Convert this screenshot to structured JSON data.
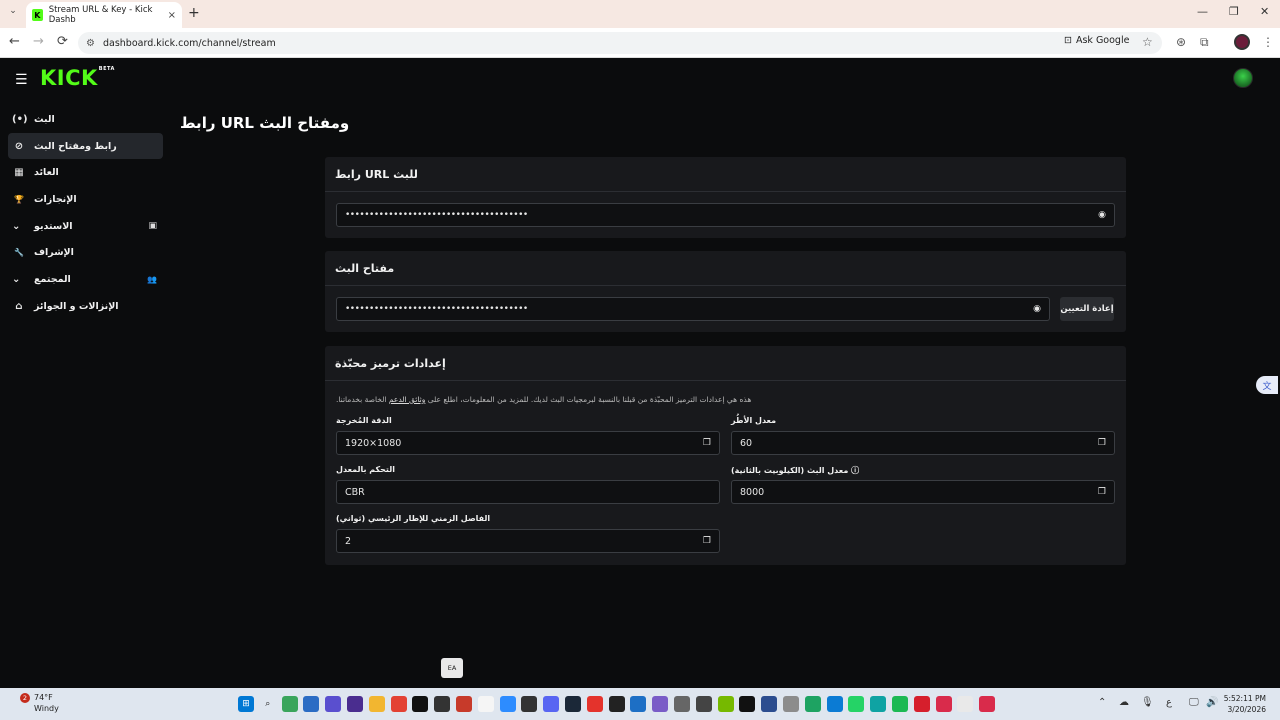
{
  "browser": {
    "tab_title": "Stream URL & Key - Kick Dashb",
    "tab_favicon": "K",
    "tab_close": "×",
    "new_tab": "+",
    "url": "dashboard.kick.com/channel/stream",
    "ask_google": "Ask Google",
    "back": "←",
    "forward": "→",
    "reload": "⟳",
    "minimize": "—",
    "restore": "❐",
    "close": "✕"
  },
  "app": {
    "logo": "KICK",
    "logo_badge": "BETA",
    "page_title": "رابط URL ومفتاح البث"
  },
  "sidebar": {
    "items": [
      {
        "label": "البث",
        "icon": "(•)"
      },
      {
        "label": "رابط ومفتاح البث",
        "icon": "⊘"
      },
      {
        "label": "العائد",
        "icon": "▦"
      },
      {
        "label": "الإنجازات",
        "icon": "🏆"
      },
      {
        "label": "الاستديو",
        "icon": "⌄",
        "right_icon": "▣"
      },
      {
        "label": "الإشراف",
        "icon": "🔧"
      },
      {
        "label": "المجتمع",
        "icon": "⌄",
        "right_icon": "👥"
      },
      {
        "label": "الإنزالات و الجوائز",
        "icon": "⌂"
      }
    ]
  },
  "stream_url_card": {
    "title": "رابط URL للبث",
    "masked_value": "••••••••••••••••••••••••••••••••••••••"
  },
  "stream_key_card": {
    "title": "مفتاح البث",
    "masked_value": "••••••••••••••••••••••••••••••••••••••",
    "reset_label": "إعادة التعيين"
  },
  "encoder_card": {
    "title": "إعدادات ترميز محبّذة",
    "description_prefix": ".هذه هي إعدادات الترميز المحبّذة من قبلنا بالنسبة لبرمجيات البث لديك. للمزيد من المعلومات، اطلع على ",
    "description_link": "وثائق الدعم",
    "description_suffix": " الخاصة بخدماتنا",
    "fields": {
      "resolution": {
        "label": "الدقة المُخرجة",
        "value": "1920×1080"
      },
      "fps": {
        "label": "معدل الأطُر",
        "value": "60"
      },
      "rate_control": {
        "label": "التحكم بالمعدل",
        "value": "CBR"
      },
      "bitrate": {
        "label": "معدل البث (الكيلوبيت بالثانية)",
        "value": "8000"
      },
      "keyframe": {
        "label": "الفاصل الزمني للإطار الرئيسي (ثواني)",
        "value": "2"
      }
    }
  },
  "tooltip": "EA",
  "taskbar": {
    "weather_temp": "74°F",
    "weather_desc": "Windy",
    "notification_count": "2",
    "time": "5:52:11 PM",
    "date": "3/20/2026",
    "lang": "ع"
  },
  "colors": {
    "kick_green": "#53fc18",
    "bg": "#0b0c0d",
    "card": "#18191c"
  }
}
